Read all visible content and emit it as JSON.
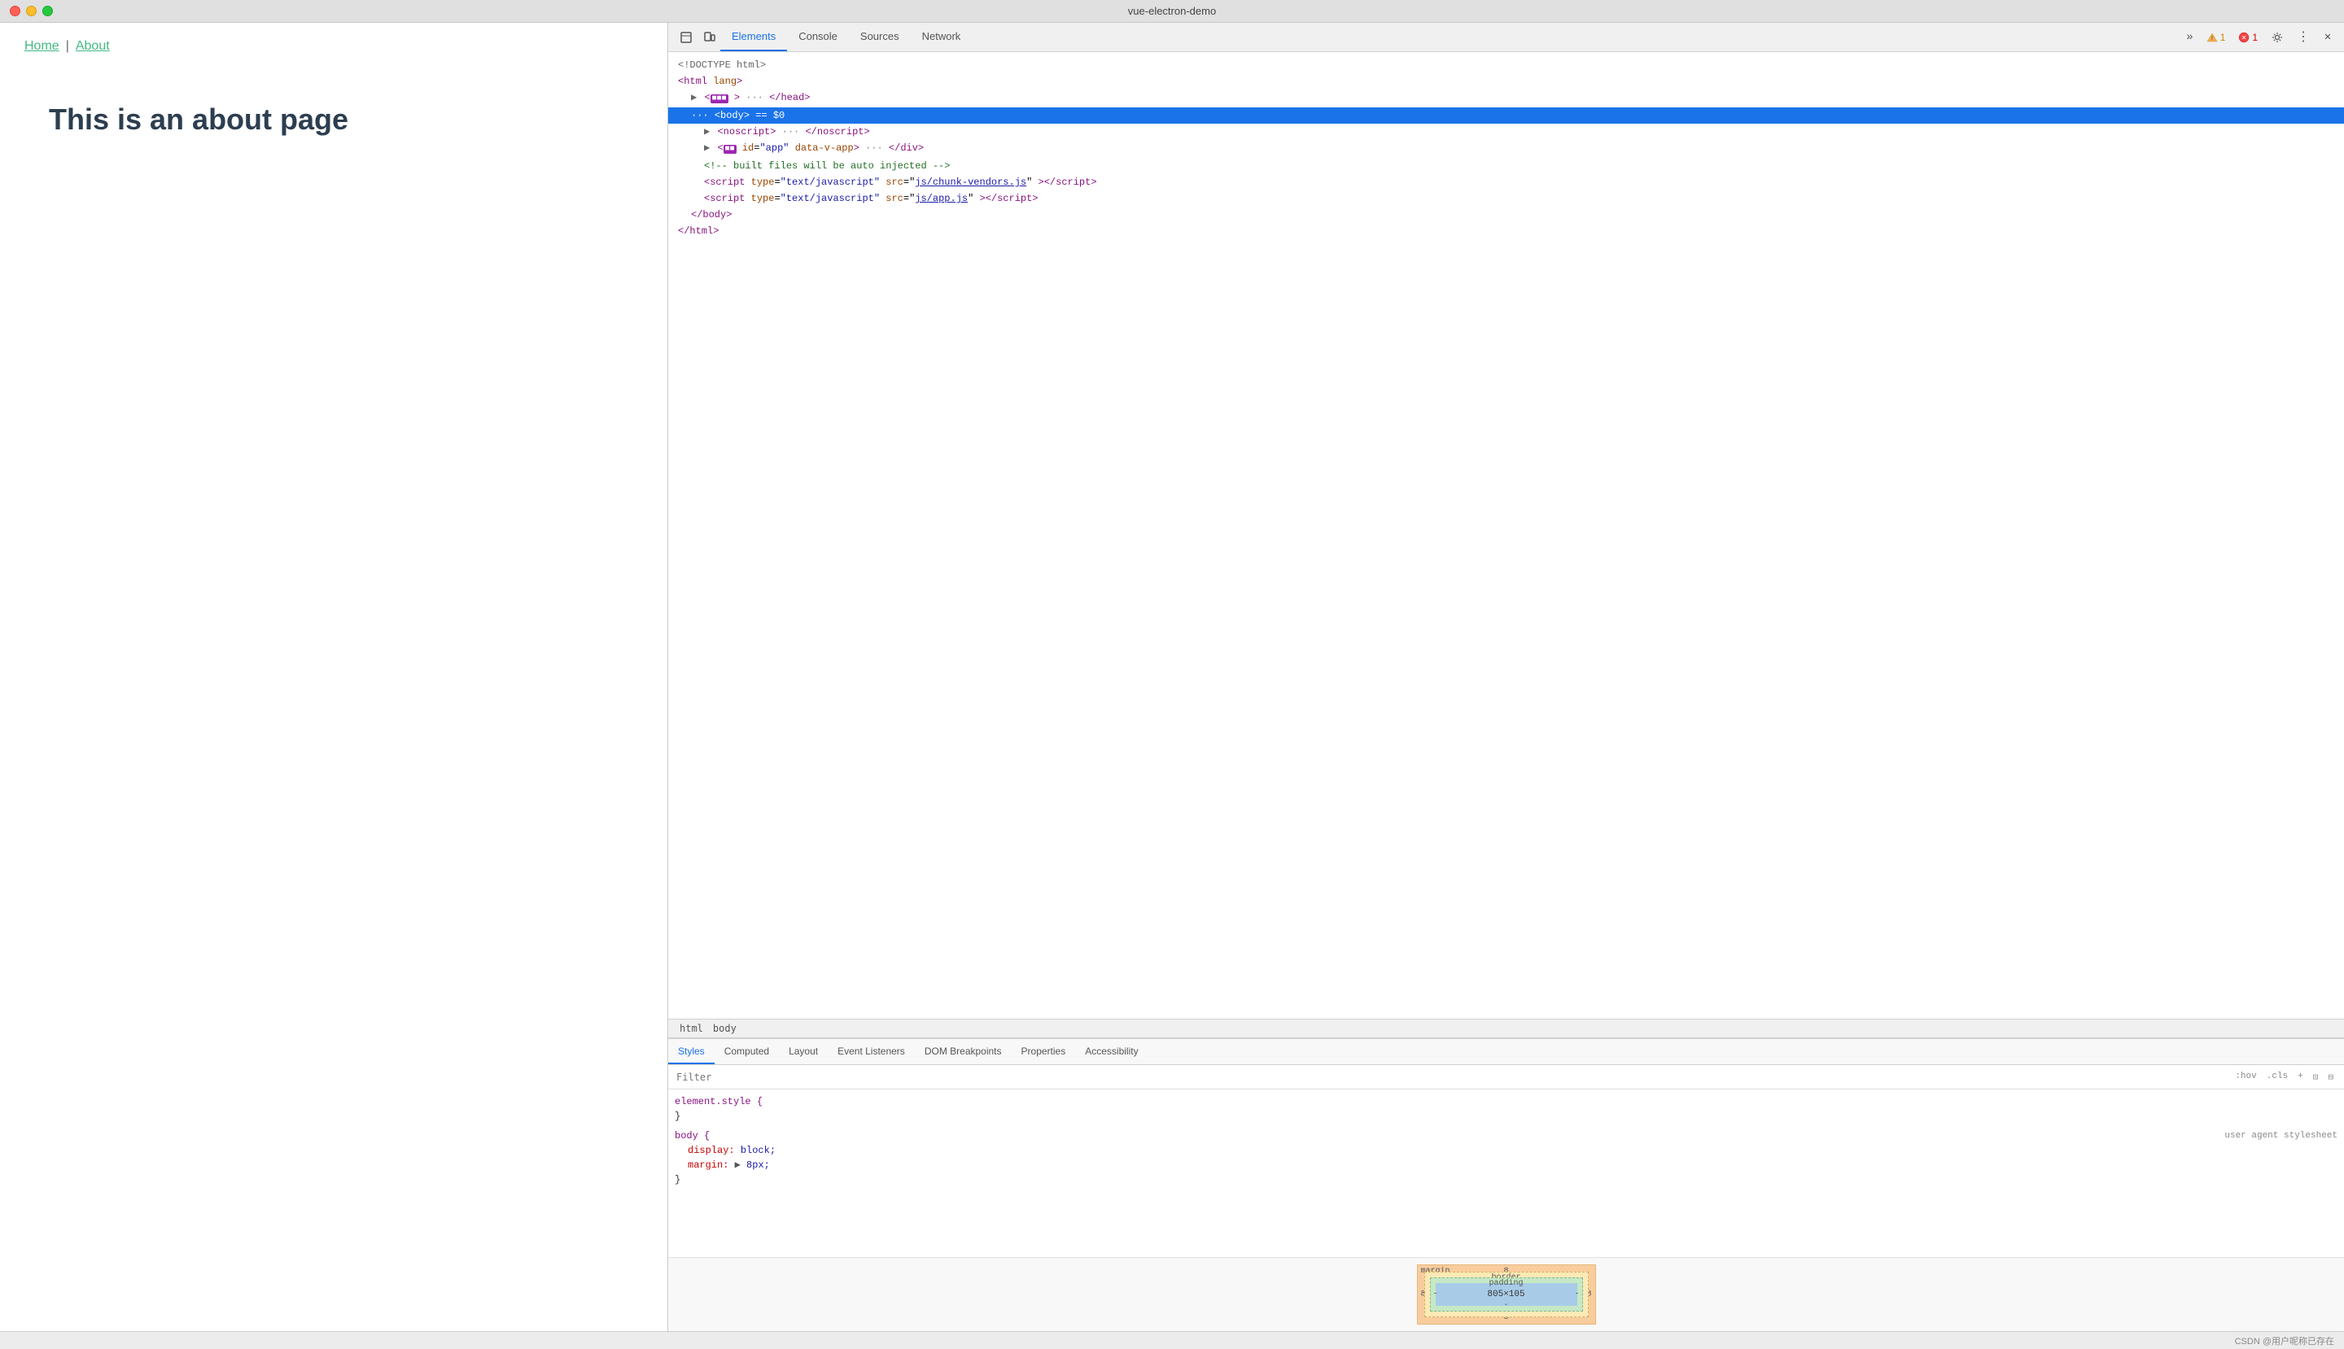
{
  "titlebar": {
    "title": "vue-electron-demo"
  },
  "app": {
    "nav": {
      "home_label": "Home",
      "separator": "|",
      "about_label": "About"
    },
    "heading": "This is an about page"
  },
  "devtools": {
    "tabs": [
      {
        "id": "elements",
        "label": "Elements",
        "active": true
      },
      {
        "id": "console",
        "label": "Console",
        "active": false
      },
      {
        "id": "sources",
        "label": "Sources",
        "active": false
      },
      {
        "id": "network",
        "label": "Network",
        "active": false
      }
    ],
    "more_btn": "»",
    "warn_count": "1",
    "err_count": "1",
    "html": [
      {
        "indent": 0,
        "content": "&lt;!DOCTYPE html&gt;",
        "type": "comment"
      },
      {
        "indent": 0,
        "content": "<span class='tag-color'>&lt;html</span> <span class='attr-name'>lang</span><span class='tag-color'>&gt;</span>",
        "type": "tag"
      },
      {
        "indent": 1,
        "content": "▶ <span class='tag-color'>&lt;</span><span style='background:#9c27b0;color:white;padding:0 3px;border-radius:2px;font-size:11px'>■■■</span><span class='tag-color'>&gt; ···</span> <span class='tag-color'>&lt;/head&gt;</span>",
        "type": "tag"
      },
      {
        "indent": 1,
        "content": "··· <span class='tag-color'>&lt;body&gt;</span> <span style='color:#888'>==</span> <span style='color:#888'>$0</span>",
        "type": "selected"
      },
      {
        "indent": 2,
        "content": "▶ <span class='tag-color'>&lt;noscript&gt;</span> <span class='ellipsis'>···</span> <span class='tag-color'>&lt;/noscript&gt;</span>",
        "type": "tag"
      },
      {
        "indent": 2,
        "content": "▶ <span class='tag-color'>&lt;</span><span style='background:#9c27b0;color:white;padding:0 3px;border-radius:2px;font-size:11px'>■■</span> <span class='attr-name'>id</span>=<span class='attr-val'>\"app\"</span> <span class='attr-name'>data-v-app</span><span class='tag-color'>&gt;</span> <span class='ellipsis'>···</span> <span class='tag-color'>&lt;/div&gt;</span>",
        "type": "tag"
      },
      {
        "indent": 2,
        "content": "<span class='comment-color'>&lt;!-- built files will be auto injected --&gt;</span>",
        "type": "comment"
      },
      {
        "indent": 2,
        "content": "<span class='tag-color'>&lt;script</span> <span class='attr-name'>type</span>=<span class='attr-val'>\"text/javascript\"</span> <span class='attr-name'>src</span>=<span class='attr-val'>\"<span style='color:#1a1aa6;text-decoration:underline'>js/chunk-vendors.js</span>\"</span><span class='tag-color'>&gt;&lt;/script&gt;</span>",
        "type": "tag"
      },
      {
        "indent": 2,
        "content": "<span class='tag-color'>&lt;script</span> <span class='attr-name'>type</span>=<span class='attr-val'>\"text/javascript\"</span> <span class='attr-name'>src</span>=<span class='attr-val'>\"<span style='color:#1a1aa6;text-decoration:underline'>js/app.js</span>\"</span><span class='tag-color'>&gt;&lt;/script&gt;</span>",
        "type": "tag"
      },
      {
        "indent": 1,
        "content": "<span class='tag-color'>&lt;/body&gt;</span>",
        "type": "tag"
      },
      {
        "indent": 0,
        "content": "<span class='tag-color'>&lt;/html&gt;</span>",
        "type": "tag"
      }
    ],
    "breadcrumb": [
      "html",
      "body"
    ],
    "styles_tabs": [
      {
        "id": "styles",
        "label": "Styles",
        "active": true
      },
      {
        "id": "computed",
        "label": "Computed",
        "active": false
      },
      {
        "id": "layout",
        "label": "Layout",
        "active": false
      },
      {
        "id": "event-listeners",
        "label": "Event Listeners",
        "active": false
      },
      {
        "id": "dom-breakpoints",
        "label": "DOM Breakpoints",
        "active": false
      },
      {
        "id": "properties",
        "label": "Properties",
        "active": false
      },
      {
        "id": "accessibility",
        "label": "Accessibility",
        "active": false
      }
    ],
    "filter": {
      "placeholder": "Filter",
      "hov": ":hov",
      "cls": ".cls",
      "plus": "+",
      "icon1": "⊡",
      "icon2": "⊟"
    },
    "css_rules": [
      {
        "selector": "element.style {",
        "props": [],
        "close": "}",
        "source": ""
      },
      {
        "selector": "body {",
        "props": [
          {
            "name": "display:",
            "value": "block;"
          },
          {
            "name": "margin:",
            "value": "▶ 8px;"
          }
        ],
        "close": "}",
        "source": "user agent stylesheet"
      }
    ],
    "box_model": {
      "margin_label": "margin",
      "margin_val": "8",
      "border_label": "border",
      "border_val": "-",
      "padding_label": "padding",
      "padding_val": "-",
      "content": "805×105",
      "left_val": "8",
      "right_val": "8",
      "bottom_val": "8"
    }
  },
  "footer": {
    "text": "CSDN @用户呢称已存在"
  }
}
